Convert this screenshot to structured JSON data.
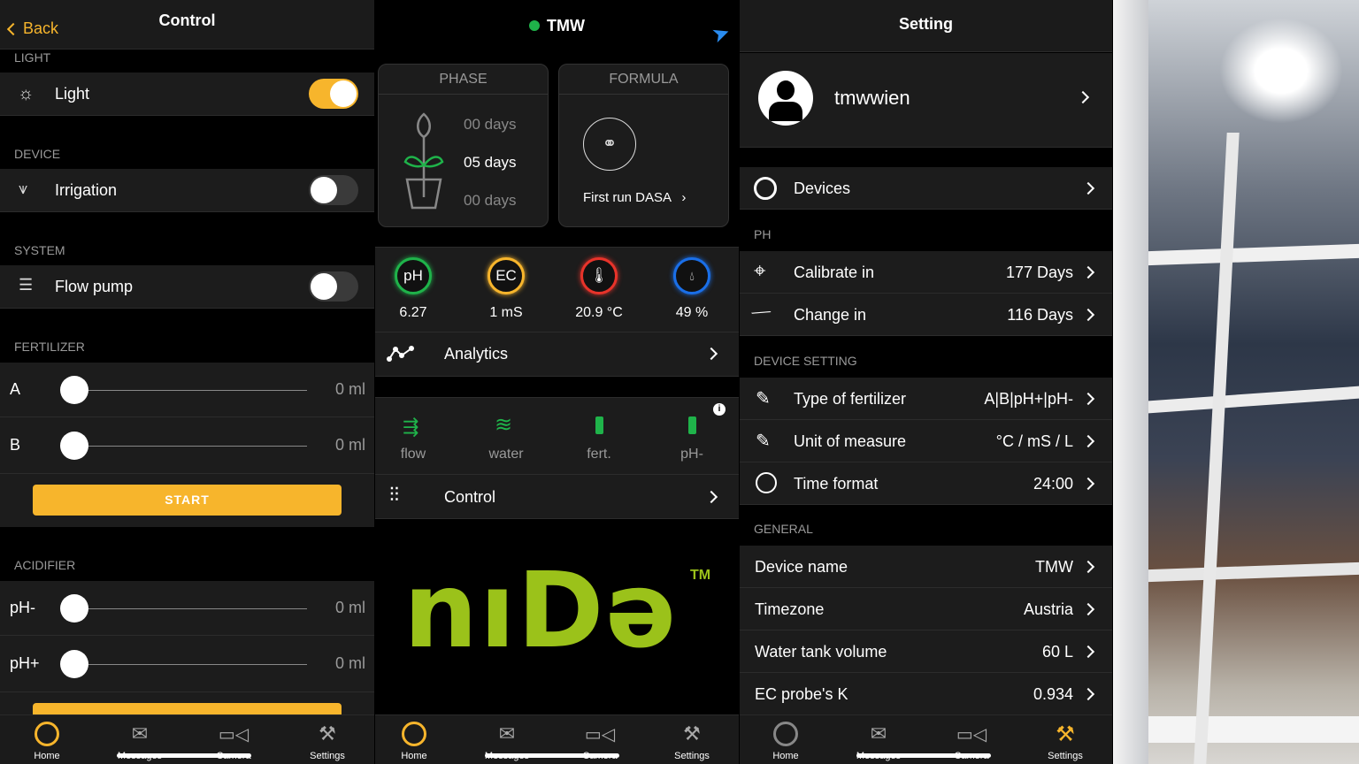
{
  "control": {
    "back": "Back",
    "title": "Control",
    "sections": {
      "light": "LIGHT",
      "device": "DEVICE",
      "system": "SYSTEM",
      "fertilizer": "FERTILIZER",
      "acidifier": "ACIDIFIER"
    },
    "light": {
      "label": "Light",
      "on": true,
      "icon": "sun-icon"
    },
    "irrigation": {
      "label": "Irrigation",
      "on": false,
      "icon": "sprinkler-icon"
    },
    "flow_pump": {
      "label": "Flow pump",
      "on": false,
      "icon": "lines-icon"
    },
    "fertilizer": [
      {
        "label": "A",
        "value": "0 ml"
      },
      {
        "label": "B",
        "value": "0 ml"
      }
    ],
    "acidifier": [
      {
        "label": "pH-",
        "value": "0 ml"
      },
      {
        "label": "pH+",
        "value": "0 ml"
      }
    ],
    "start": "START"
  },
  "home": {
    "title": "TMW",
    "status_color": "#1fb34a",
    "phase": {
      "title": "PHASE",
      "days": [
        "00 days",
        "05 days",
        "00 days"
      ]
    },
    "formula": {
      "title": "FORMULA",
      "name": "First run DASA"
    },
    "sensors": [
      {
        "symbol": "pH",
        "value": "6.27",
        "color": "#1fb34a"
      },
      {
        "symbol": "EC",
        "value": "1 mS",
        "color": "#f7b52c"
      },
      {
        "symbol": "",
        "value": "20.9 °C",
        "color": "#e8332a",
        "icon": "thermometer-icon"
      },
      {
        "symbol": "",
        "value": "49 %",
        "color": "#1a6fe8",
        "icon": "drops-icon"
      }
    ],
    "analytics": "Analytics",
    "status": [
      "flow",
      "water",
      "fert.",
      "pH-"
    ],
    "control": "Control",
    "logo": "NIDO",
    "tm": "TM"
  },
  "settings": {
    "title": "Setting",
    "user": "tmwwien",
    "devices": "Devices",
    "sections": {
      "ph": "PH",
      "device_setting": "DEVICE SETTING",
      "general": "GENERAL"
    },
    "ph_rows": [
      {
        "label": "Calibrate in",
        "value": "177 Days"
      },
      {
        "label": "Change in",
        "value": "116 Days"
      }
    ],
    "device_rows": [
      {
        "label": "Type of fertilizer",
        "value": "A|B|pH+|pH-"
      },
      {
        "label": "Unit of measure",
        "value": "°C / mS / L"
      },
      {
        "label": "Time format",
        "value": "24:00"
      }
    ],
    "general_rows": [
      {
        "label": "Device name",
        "value": "TMW"
      },
      {
        "label": "Timezone",
        "value": "Austria"
      },
      {
        "label": "Water tank volume",
        "value": "60 L"
      },
      {
        "label": "EC probe's K",
        "value": "0.934"
      }
    ]
  },
  "tabbar": {
    "tabs": [
      "Home",
      "Messages",
      "Camera",
      "Settings"
    ],
    "accent": "#f7b52c"
  }
}
